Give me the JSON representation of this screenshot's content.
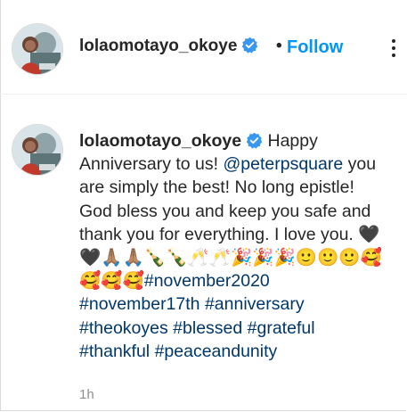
{
  "post": {
    "author": {
      "username": "lolaomotayo_okoye",
      "verified": true
    },
    "separator": "•",
    "follow_label": "Follow",
    "more_options_icon": "more-options-icon"
  },
  "comment": {
    "username": "lolaomotayo_okoye",
    "segments": [
      {
        "type": "text",
        "value": "Happy Anniversary to us! "
      },
      {
        "type": "mention",
        "value": "@peterpsquare"
      },
      {
        "type": "text",
        "value": " you are simply the best! No long epistle! God bless you and keep you safe and thank you for everything. I love you. "
      },
      {
        "type": "emoji",
        "value": "🖤🖤🙏🏽🙏🏽🍾🍾🥂🥂🎉🎉🎉🙂🙂🙂🥰🥰🥰🥰"
      },
      {
        "type": "hashtag",
        "value": "#november2020"
      },
      {
        "type": "text",
        "value": " "
      },
      {
        "type": "hashtag",
        "value": "#november17th"
      },
      {
        "type": "text",
        "value": " "
      },
      {
        "type": "hashtag",
        "value": "#anniversary"
      },
      {
        "type": "text",
        "value": " "
      },
      {
        "type": "hashtag",
        "value": "#theokoyes"
      },
      {
        "type": "text",
        "value": " "
      },
      {
        "type": "hashtag",
        "value": "#blessed"
      },
      {
        "type": "text",
        "value": " "
      },
      {
        "type": "hashtag",
        "value": "#grateful"
      },
      {
        "type": "text",
        "value": " "
      },
      {
        "type": "hashtag",
        "value": "#thankful"
      },
      {
        "type": "text",
        "value": " "
      },
      {
        "type": "hashtag",
        "value": "#peaceandunity"
      }
    ],
    "timestamp": "1h"
  },
  "colors": {
    "link": "#00376b",
    "follow": "#0095f6",
    "verified": "#3897f0",
    "muted": "#8e8e8e"
  }
}
